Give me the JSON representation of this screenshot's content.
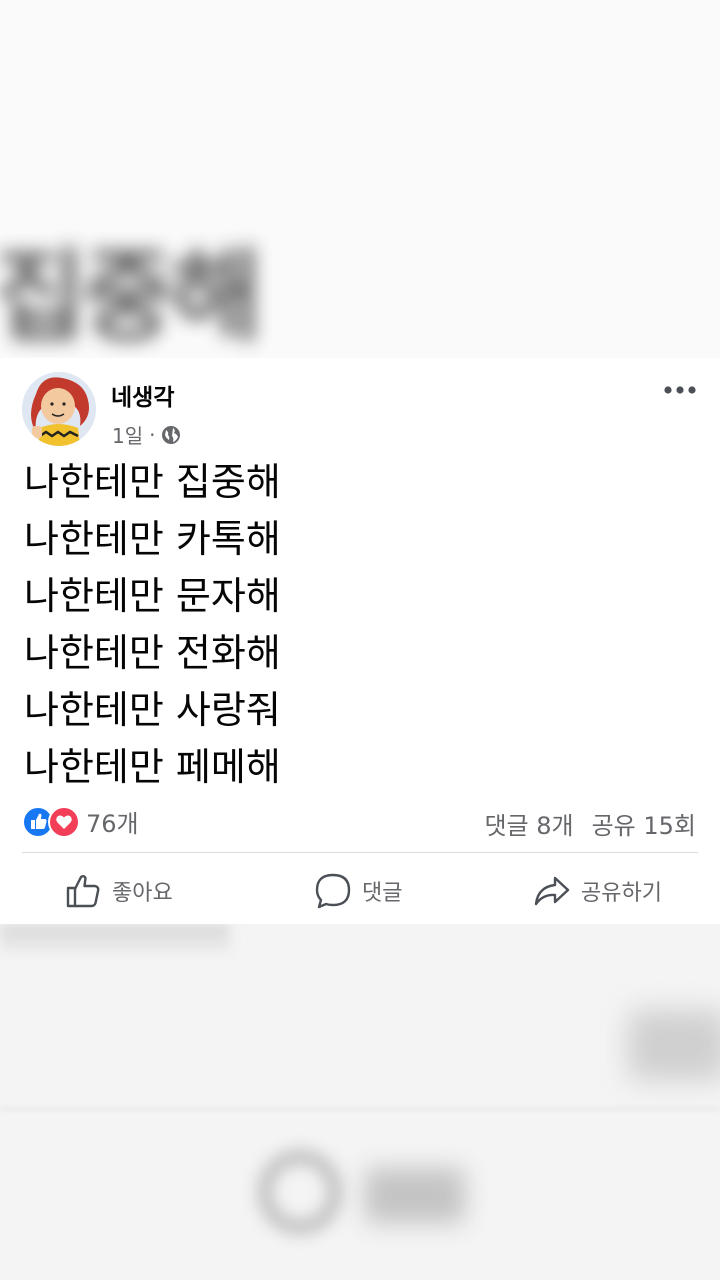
{
  "background_blur": {
    "text": "집중해"
  },
  "post": {
    "author": "네생각",
    "time": "1일",
    "separator": "·",
    "lines": [
      "나한테만 집중해",
      "나한테만 카톡해",
      "나한테만 문자해",
      "나한테만 전화해",
      "나한테만 사랑줘",
      "나한테만 페메해"
    ],
    "reaction_count": "76개",
    "comment_count": "댓글 8개",
    "share_count": "공유 15회"
  },
  "actions": {
    "like": "좋아요",
    "comment": "댓글",
    "share": "공유하기"
  },
  "icons": {
    "like": "like-reaction-icon",
    "love": "love-reaction-icon",
    "privacy": "globe-icon",
    "more": "more-icon",
    "thumb": "thumbs-up-icon",
    "bubble": "comment-bubble-icon",
    "share": "share-arrow-icon"
  },
  "colors": {
    "like_blue": "#1877f2",
    "love_red": "#f33e58",
    "secondary_text": "#65676b",
    "primary_text": "#050505"
  }
}
